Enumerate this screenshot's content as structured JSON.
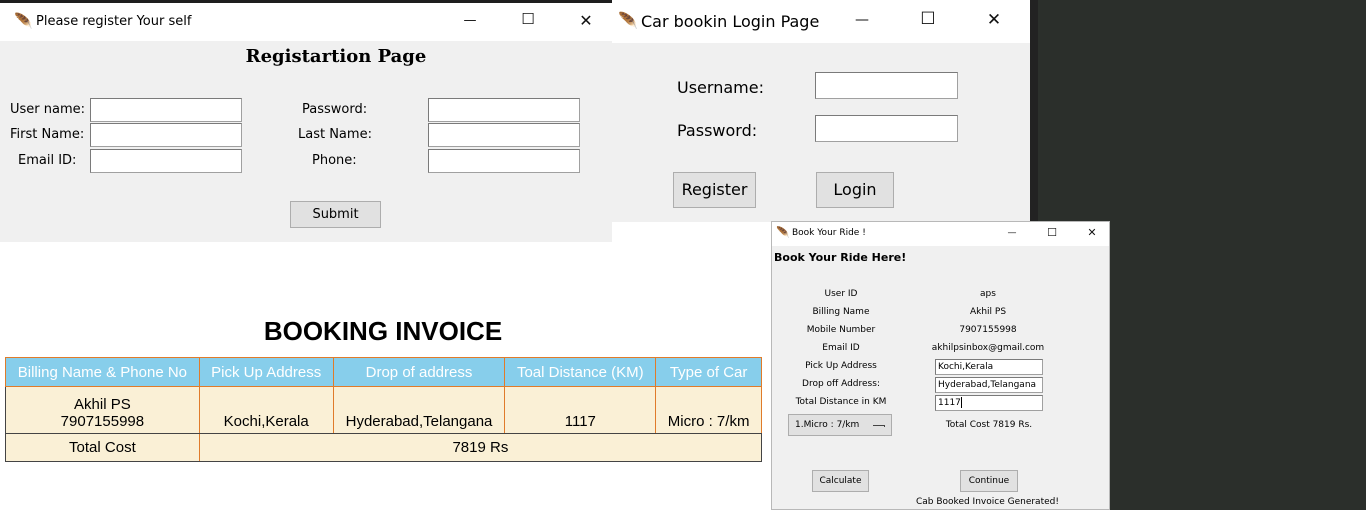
{
  "register_window": {
    "title": "Please register Your self",
    "heading": "Registartion Page",
    "labels": {
      "username": "User name:",
      "first_name": "First Name:",
      "email": "Email ID:",
      "password": "Password:",
      "last_name": "Last Name:",
      "phone": "Phone:"
    },
    "submit_label": "Submit"
  },
  "login_window": {
    "title": "Car bookin Login Page",
    "username_label": "Username:",
    "password_label": "Password:",
    "register_label": "Register",
    "login_label": "Login"
  },
  "invoice": {
    "title": "BOOKING INVOICE",
    "headers": [
      "Billing Name & Phone No",
      "Pick Up Address",
      "Drop of address",
      "Toal Distance (KM)",
      "Type of Car"
    ],
    "row": {
      "name": "Akhil  PS",
      "phone": "7907155998",
      "pickup": "Kochi,Kerala",
      "drop": "Hyderabad,Telangana",
      "distance": "1117",
      "car": "Micro : 7/km"
    },
    "total_label": "Total Cost",
    "total_value": "7819 Rs"
  },
  "ride_window": {
    "title": "Book Your Ride !",
    "heading": "Book Your Ride Here!",
    "labels": {
      "user_id": "User ID",
      "billing_name": "Billing Name",
      "mobile": "Mobile Number",
      "email": "Email ID",
      "pickup": "Pick Up Address",
      "dropoff": "Drop off Address:",
      "distance": "Total Distance in KM"
    },
    "values": {
      "user_id": "aps",
      "billing_name": "Akhil  PS",
      "mobile": "7907155998",
      "email": "akhilpsinbox@gmail.com",
      "pickup": "Kochi,Kerala",
      "dropoff": "Hyderabad,Telangana",
      "distance": "1117"
    },
    "car_option": "1.Micro : 7/km",
    "total_cost": "Total Cost 7819 Rs.",
    "calculate_label": "Calculate",
    "continue_label": "Continue",
    "status": "Cab Booked Invoice Generated!"
  },
  "window_controls": {
    "minimize": "—",
    "maximize": "☐",
    "close": "✕"
  },
  "icons": {
    "app_icon": "feather-icon"
  }
}
